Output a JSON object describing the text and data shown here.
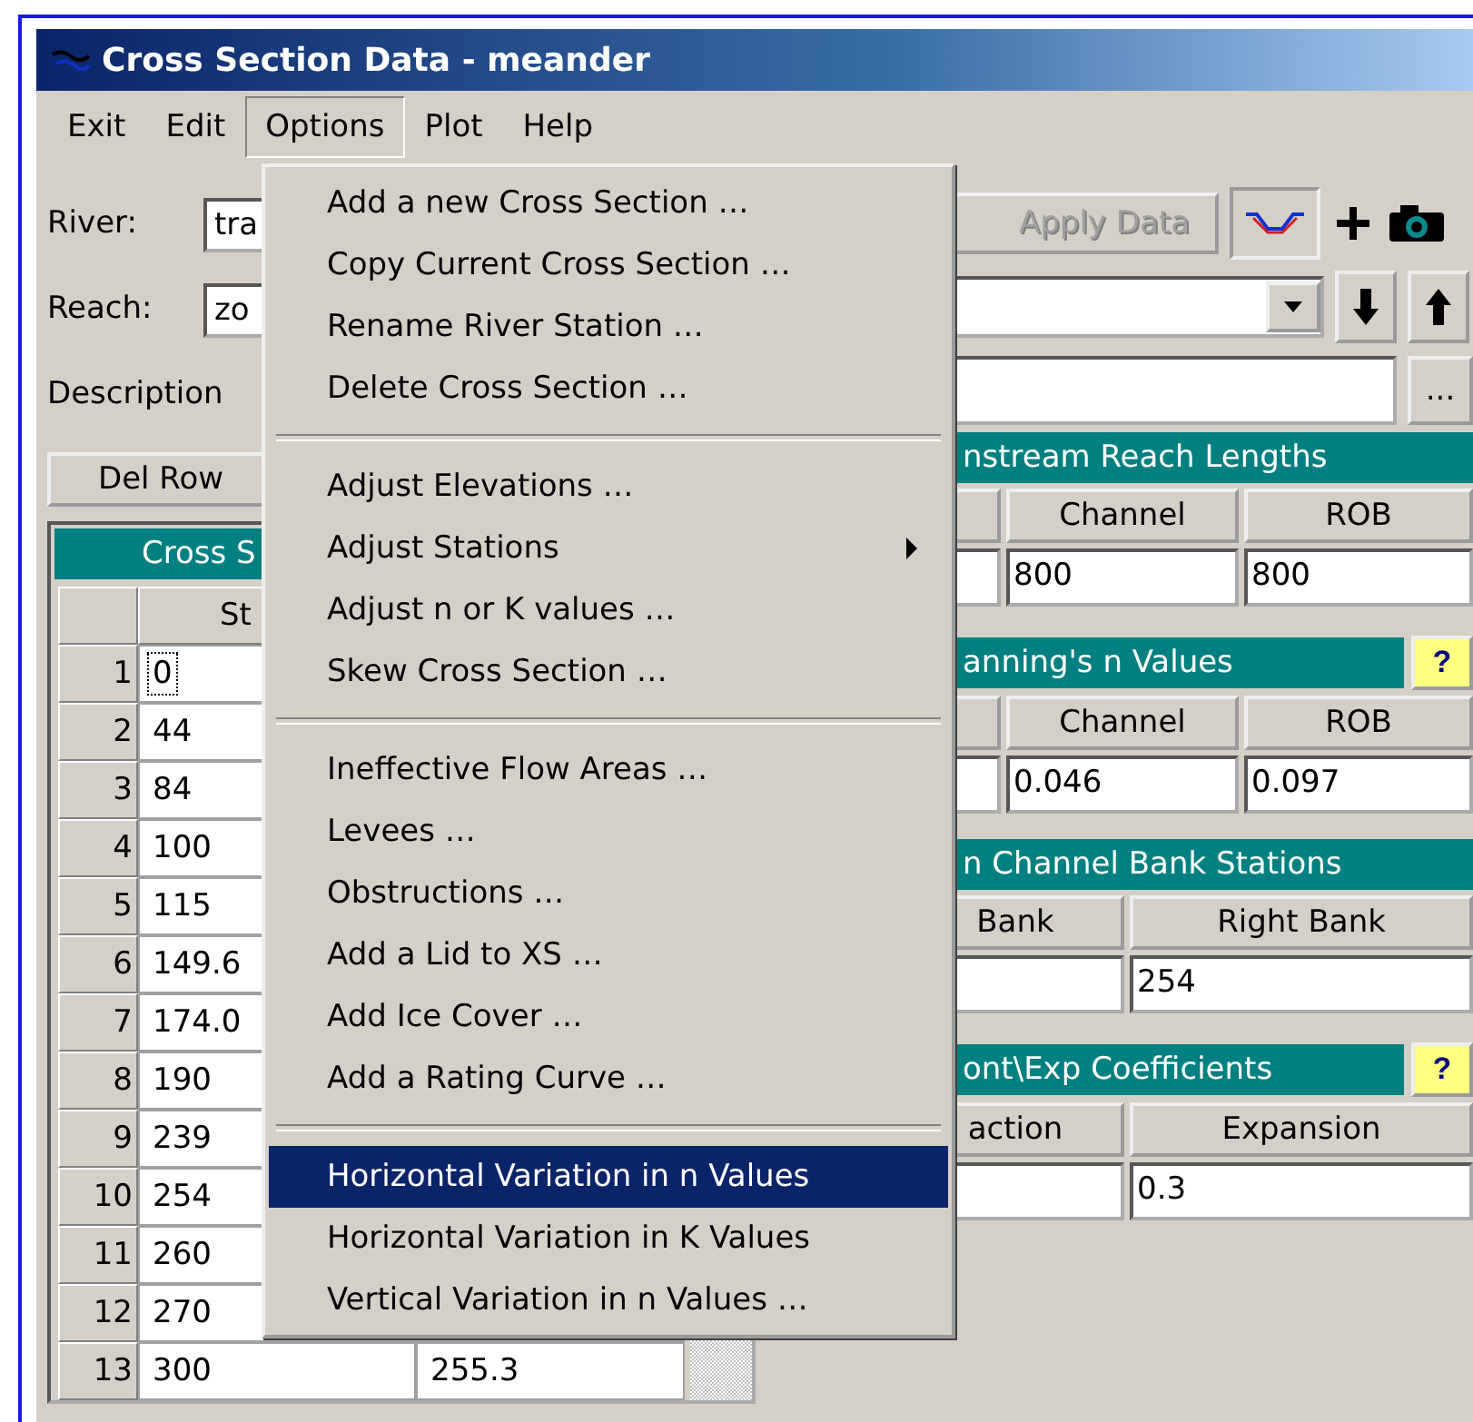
{
  "window": {
    "title": "Cross Section Data - meander"
  },
  "menu_bar": [
    {
      "label": "Exit",
      "selected": false
    },
    {
      "label": "Edit",
      "selected": false
    },
    {
      "label": "Options",
      "selected": true
    },
    {
      "label": "Plot",
      "selected": false
    },
    {
      "label": "Help",
      "selected": false
    }
  ],
  "options_menu": [
    [
      {
        "label": "Add a new Cross Section …",
        "kind": "item",
        "selected": false
      },
      {
        "label": "Copy Current Cross Section …",
        "kind": "item",
        "selected": false
      },
      {
        "label": "Rename River Station …",
        "kind": "item",
        "selected": false
      },
      {
        "label": "Delete Cross Section …",
        "kind": "item",
        "selected": false
      }
    ],
    [
      {
        "label": "Adjust Elevations …",
        "kind": "item",
        "selected": false
      },
      {
        "label": "Adjust Stations",
        "kind": "submenu",
        "selected": false
      },
      {
        "label": "Adjust n or K values …",
        "kind": "item",
        "selected": false
      },
      {
        "label": "Skew Cross Section …",
        "kind": "item",
        "selected": false
      }
    ],
    [
      {
        "label": "Ineffective Flow Areas …",
        "kind": "item",
        "selected": false
      },
      {
        "label": "Levees …",
        "kind": "item",
        "selected": false
      },
      {
        "label": "Obstructions …",
        "kind": "item",
        "selected": false
      },
      {
        "label": "Add a Lid to XS …",
        "kind": "item",
        "selected": false
      },
      {
        "label": "Add Ice Cover …",
        "kind": "item",
        "selected": false
      },
      {
        "label": "Add a Rating Curve …",
        "kind": "item",
        "selected": false
      }
    ],
    [
      {
        "label": "Horizontal Variation in n Values",
        "kind": "item",
        "selected": true
      },
      {
        "label": "Horizontal Variation in K Values",
        "kind": "item",
        "selected": false
      },
      {
        "label": "Vertical Variation in n Values …",
        "kind": "item",
        "selected": false
      }
    ]
  ],
  "river": {
    "label": "River:",
    "value": "tra"
  },
  "reach": {
    "label": "Reach:",
    "value": "zo"
  },
  "description": {
    "label": "Description",
    "more_button": "..."
  },
  "apply_button": {
    "label": "Apply Data",
    "disabled": true
  },
  "del_row_button": "Del Row",
  "table": {
    "title": "Cross S",
    "column": "St",
    "rows": [
      {
        "index": "1",
        "station": "0",
        "focused": true
      },
      {
        "index": "2",
        "station": "44",
        "focused": false
      },
      {
        "index": "3",
        "station": "84",
        "focused": false
      },
      {
        "index": "4",
        "station": "100",
        "focused": false
      },
      {
        "index": "5",
        "station": "115",
        "focused": false
      },
      {
        "index": "6",
        "station": "149.6",
        "focused": false
      },
      {
        "index": "7",
        "station": "174.0",
        "focused": false
      },
      {
        "index": "8",
        "station": "190",
        "focused": false
      },
      {
        "index": "9",
        "station": "239",
        "focused": false
      },
      {
        "index": "10",
        "station": "254",
        "focused": false
      },
      {
        "index": "11",
        "station": "260",
        "focused": false
      },
      {
        "index": "12",
        "station": "270",
        "focused": false
      },
      {
        "index": "13",
        "station": "300",
        "elevation": "255.3",
        "focused": false
      }
    ]
  },
  "panels": [
    {
      "title": "nstream Reach Lengths",
      "kind": "three",
      "columns": [
        {
          "heading": "Channel",
          "value": "800"
        },
        {
          "heading": "ROB",
          "value": "800"
        }
      ]
    },
    {
      "title": "anning's n Values",
      "kind": "three",
      "help": "?",
      "columns": [
        {
          "heading": "Channel",
          "value": "0.046"
        },
        {
          "heading": "ROB",
          "value": "0.097"
        }
      ]
    },
    {
      "title": "n Channel Bank Stations",
      "kind": "two",
      "columns": [
        {
          "heading": "Bank"
        },
        {
          "heading": "Right Bank",
          "value": "254"
        }
      ]
    },
    {
      "title": "ont\\Exp  Coefficients",
      "kind": "two",
      "help": "?",
      "columns": [
        {
          "heading": "action"
        },
        {
          "heading": "Expansion",
          "value": "0.3"
        }
      ]
    }
  ]
}
